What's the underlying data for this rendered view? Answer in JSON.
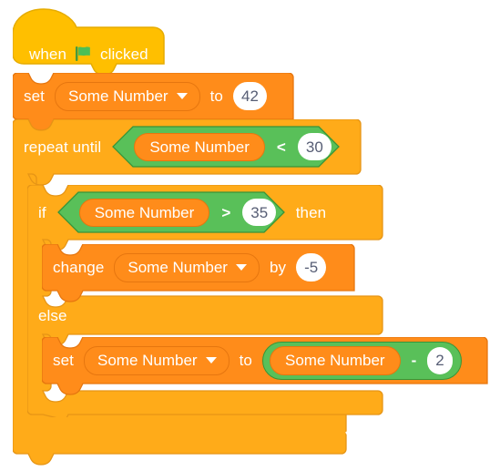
{
  "program": {
    "title": "Scratch script",
    "colors": {
      "events": "#FFBF00",
      "events_outline": "#E6AC00",
      "control": "#FFAB19",
      "control_outline": "#E69516",
      "variables": "#FF8C1A",
      "variables_outline": "#E6760F",
      "operators": "#59C059",
      "operators_outline": "#389438",
      "input_text": "#575E75",
      "label_text": "#FFFFFF",
      "flag_green": "#45993D",
      "canvas": "#FFFFFF"
    },
    "blocks": {
      "hat": {
        "label_when": "when",
        "icon": "green-flag-icon",
        "label_clicked": "clicked"
      },
      "set_init": {
        "label_set": "set",
        "variable": "Some Number",
        "label_to": "to",
        "value": "42"
      },
      "repeat_until": {
        "label": "repeat until",
        "condition": {
          "left_variable": "Some Number",
          "operator": "<",
          "right_value": "30"
        }
      },
      "if_else": {
        "label_if": "if",
        "label_then": "then",
        "label_else": "else",
        "condition": {
          "left_variable": "Some Number",
          "operator": ">",
          "right_value": "35"
        }
      },
      "change_by": {
        "label_change": "change",
        "variable": "Some Number",
        "label_by": "by",
        "value": "-5"
      },
      "set_decrement": {
        "label_set": "set",
        "variable": "Some Number",
        "label_to": "to",
        "expression": {
          "left_variable": "Some Number",
          "operator": "-",
          "right_value": "2"
        }
      }
    }
  }
}
